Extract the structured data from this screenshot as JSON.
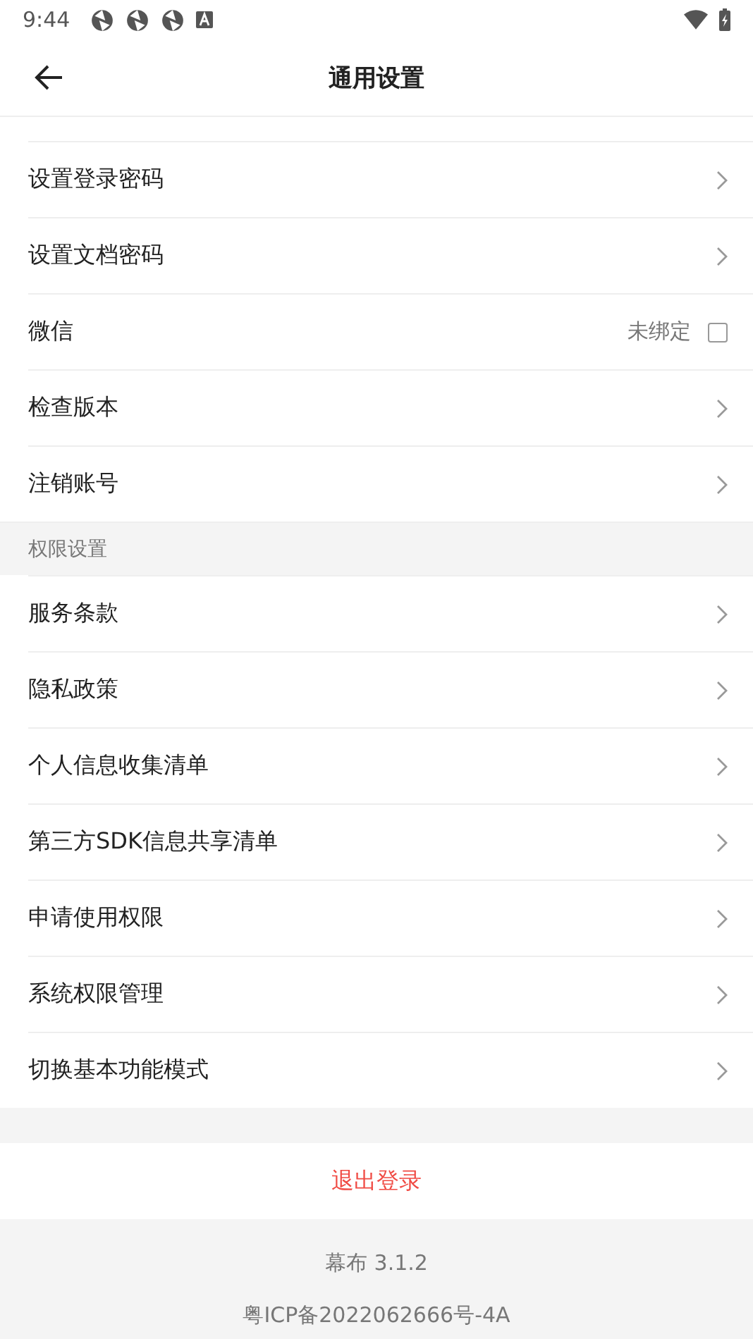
{
  "status_bar": {
    "time": "9:44"
  },
  "header": {
    "title": "通用设置"
  },
  "groups": [
    {
      "items": [
        {
          "kind": "link",
          "label": "设置登录密码"
        },
        {
          "kind": "link",
          "label": "设置文档密码"
        },
        {
          "kind": "binding",
          "label": "微信",
          "value": "未绑定",
          "checked": false
        },
        {
          "kind": "link",
          "label": "检查版本"
        },
        {
          "kind": "link",
          "label": "注销账号"
        }
      ]
    },
    {
      "title": "权限设置",
      "items": [
        {
          "kind": "link",
          "label": "服务条款"
        },
        {
          "kind": "link",
          "label": "隐私政策"
        },
        {
          "kind": "link",
          "label": "个人信息收集清单"
        },
        {
          "kind": "link",
          "label": "第三方SDK信息共享清单"
        },
        {
          "kind": "link",
          "label": "申请使用权限"
        },
        {
          "kind": "link",
          "label": "系统权限管理"
        },
        {
          "kind": "link",
          "label": "切换基本功能模式"
        }
      ]
    }
  ],
  "logout_button": "退出登录",
  "footer": {
    "version": "幕布 3.1.2",
    "icp": "粤ICP备2022062666号-4A"
  }
}
